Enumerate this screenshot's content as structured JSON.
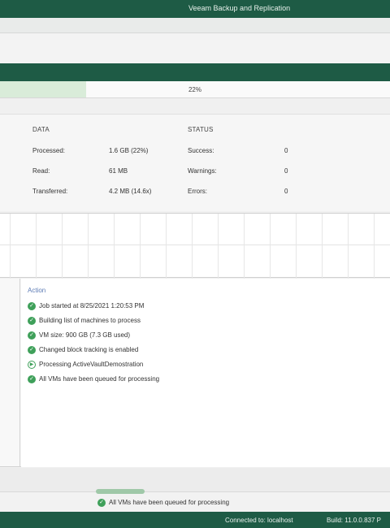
{
  "window": {
    "title": "Veeam Backup and Replication"
  },
  "progress": {
    "percent_label": "22%",
    "fraction": 0.22
  },
  "data_section": {
    "heading": "DATA",
    "rows": [
      {
        "label": "Processed:",
        "value": "1.6 GB (22%)"
      },
      {
        "label": "Read:",
        "value": "61 MB"
      },
      {
        "label": "Transferred:",
        "value": "4.2 MB (14.6x)"
      }
    ]
  },
  "status_section": {
    "heading": "STATUS",
    "rows": [
      {
        "label": "Success:",
        "value": "0"
      },
      {
        "label": "Warnings:",
        "value": "0"
      },
      {
        "label": "Errors:",
        "value": "0"
      }
    ]
  },
  "action_log": {
    "header": "Action",
    "entries": [
      {
        "icon": "success-check-icon",
        "text": "Job started at 8/25/2021 1:20:53 PM"
      },
      {
        "icon": "success-check-icon",
        "text": "Building list of machines to process"
      },
      {
        "icon": "success-check-icon",
        "text": "VM size: 900 GB (7.3 GB used)"
      },
      {
        "icon": "success-check-icon",
        "text": "Changed block tracking is enabled"
      },
      {
        "icon": "in-progress-icon",
        "text": "Processing ActiveVaultDemostration"
      },
      {
        "icon": "success-check-icon",
        "text": "All VMs have been queued for processing"
      }
    ]
  },
  "lower_log": {
    "icon": "success-check-icon",
    "text": "All VMs have been queued for processing"
  },
  "statusbar": {
    "connection": "Connected to: localhost",
    "build": "Build: 11.0.0.837 P"
  },
  "colors": {
    "brand_green": "#1e5b45",
    "success_green": "#3fa05a",
    "action_header": "#5d7cb5"
  }
}
